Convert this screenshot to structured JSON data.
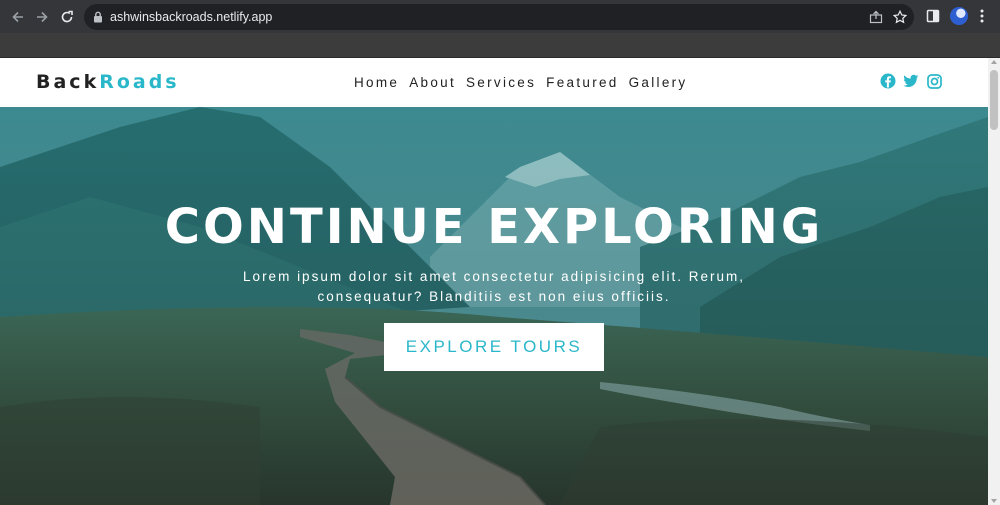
{
  "browser": {
    "url": "ashwinsbackroads.netlify.app"
  },
  "brand": {
    "part1": "Back",
    "part2": "Roads",
    "accent_color": "#2ab7ca"
  },
  "nav": {
    "links": [
      "Home",
      "About",
      "Services",
      "Featured",
      "Gallery"
    ]
  },
  "socials": [
    "facebook-icon",
    "twitter-icon",
    "instagram-icon"
  ],
  "hero": {
    "title": "CONTINUE EXPLORING",
    "text": "Lorem ipsum dolor sit amet consectetur adipisicing elit. Rerum, consequatur? Blanditiis est non eius officiis.",
    "button_label": "EXPLORE TOURS"
  }
}
